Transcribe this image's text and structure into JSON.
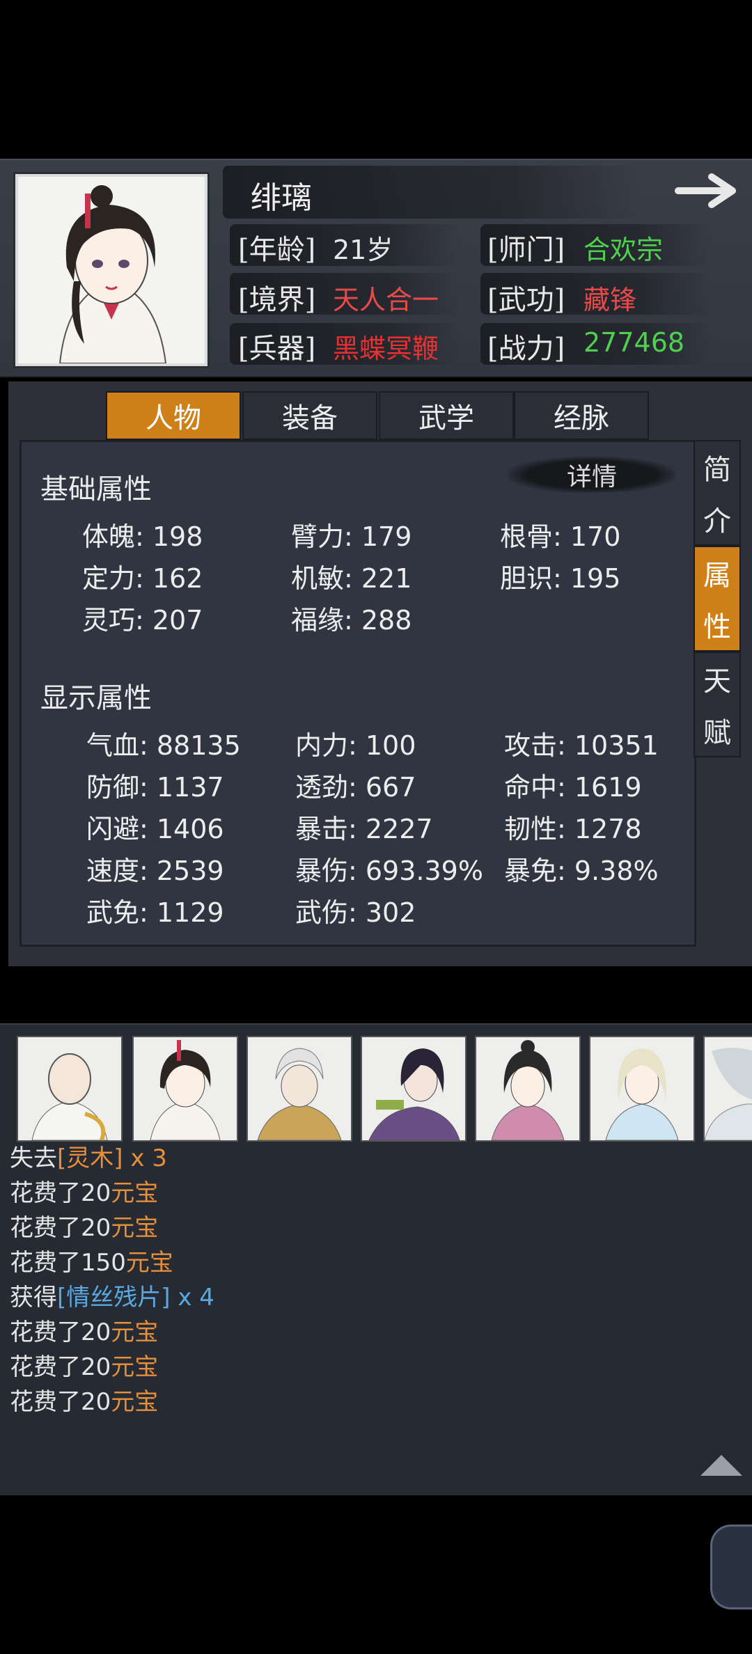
{
  "header": {
    "name": "绯璃",
    "rows": [
      {
        "label": "[年龄]",
        "value": "21岁",
        "color": "#e8e8e8"
      },
      {
        "label": "[师门]",
        "value": "合欢宗",
        "color": "#4fd14f"
      },
      {
        "label": "[境界]",
        "value": "天人合一",
        "color": "#e84a4a"
      },
      {
        "label": "[武功]",
        "value": "藏锋",
        "color": "#e84a4a"
      },
      {
        "label": "[兵器]",
        "value": "黑蝶冥鞭",
        "color": "#e83030"
      },
      {
        "label": "[战力]",
        "value": "277468",
        "color": "#4fd14f"
      }
    ],
    "forward_icon": "arrow-right-icon"
  },
  "tabs": [
    "人物",
    "装备",
    "武学",
    "经脉"
  ],
  "active_tab": 0,
  "side_tabs": [
    {
      "label": "简介",
      "chars": [
        "简",
        "介"
      ]
    },
    {
      "label": "属性",
      "chars": [
        "属",
        "性"
      ]
    },
    {
      "label": "天赋",
      "chars": [
        "天",
        "赋"
      ]
    }
  ],
  "detail_button": "详情",
  "basic": {
    "title": "基础属性",
    "items": [
      "体魄: 198",
      "臂力: 179",
      "根骨: 170",
      "定力: 162",
      "机敏: 221",
      "胆识: 195",
      "灵巧: 207",
      "福缘: 288"
    ]
  },
  "display": {
    "title": "显示属性",
    "items": [
      "气血: 88135",
      "内力: 100",
      "攻击: 10351",
      "防御: 1137",
      "透劲: 667",
      "命中: 1619",
      "闪避: 1406",
      "暴击: 2227",
      "韧性: 1278",
      "速度: 2539",
      "暴伤: 693.39%",
      "暴免: 9.38%",
      "武免: 1129",
      "武伤: 302"
    ]
  },
  "log": [
    {
      "pre": "失去",
      "item": "[灵木]",
      "cls": "orange",
      "post": " x 3"
    },
    {
      "pre": "花费了20",
      "item": "元宝",
      "cls": "orange",
      "post": ""
    },
    {
      "pre": "花费了20",
      "item": "元宝",
      "cls": "orange",
      "post": ""
    },
    {
      "pre": "花费了150",
      "item": "元宝",
      "cls": "orange",
      "post": ""
    },
    {
      "pre": "获得",
      "item": "[情丝残片]",
      "cls": "blue",
      "post": " x 4"
    },
    {
      "pre": "花费了20",
      "item": "元宝",
      "cls": "orange",
      "post": ""
    },
    {
      "pre": "花费了20",
      "item": "元宝",
      "cls": "orange",
      "post": ""
    },
    {
      "pre": "花费了20",
      "item": "元宝",
      "cls": "orange",
      "post": ""
    }
  ],
  "thumbnails": [
    "monk-portrait",
    "lady-portrait",
    "hooded-portrait",
    "purple-warrior-portrait",
    "noble-lady-portrait",
    "white-hair-portrait",
    "partial-portrait"
  ],
  "colors": {
    "accent": "#cf8019",
    "green": "#4fd14f",
    "red": "#e84a4a",
    "orange": "#e58f3a",
    "blue": "#5aa8e0"
  }
}
